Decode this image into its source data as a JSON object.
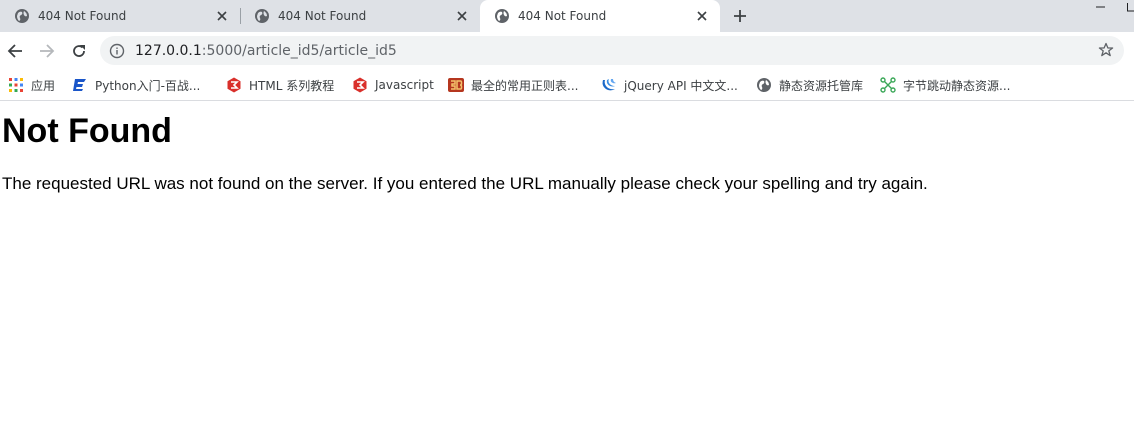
{
  "tabs": [
    {
      "title": "404 Not Found",
      "active": false
    },
    {
      "title": "404 Not Found",
      "active": false
    },
    {
      "title": "404 Not Found",
      "active": true
    }
  ],
  "address_bar": {
    "host": "127.0.0.1",
    "path": ":5000/article_id5/article_id5"
  },
  "bookmarks": [
    {
      "label": "应用",
      "icon": "apps-grid-icon"
    },
    {
      "label": "Python入门-百战...",
      "icon": "baizhan-logo-icon"
    },
    {
      "label": "HTML 系列教程",
      "icon": "w3school-logo-icon"
    },
    {
      "label": "Javascript",
      "icon": "w3school-logo-icon"
    },
    {
      "label": "最全的常用正则表...",
      "icon": "site-logo-icon"
    },
    {
      "label": "jQuery API 中文文...",
      "icon": "jquery-logo-icon"
    },
    {
      "label": "静态资源托管库",
      "icon": "globe-icon"
    },
    {
      "label": "字节跳动静态资源...",
      "icon": "bytedance-logo-icon"
    }
  ],
  "page": {
    "heading": "Not Found",
    "message": "The requested URL was not found on the server. If you entered the URL manually please check your spelling and try again."
  },
  "colors": {
    "tabstrip_bg": "#dee1e6",
    "omnibox_bg": "#f1f3f4",
    "icon_gray": "#5f6368"
  }
}
